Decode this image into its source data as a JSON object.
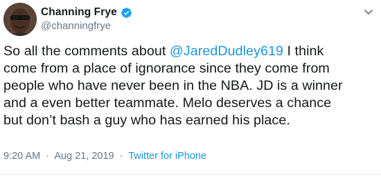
{
  "author": {
    "display_name": "Channing Frye",
    "handle": "@channingfrye",
    "verified": true,
    "verified_color": "#1da1f2"
  },
  "tweet": {
    "line1_before": "So all the comments about ",
    "mention": "@JaredDudley619",
    "line1_after": " I think",
    "line2": "come from a place of ignorance since they come from",
    "line3": "people who have never been in the NBA. JD is a winner",
    "line4": "and a even better teammate. Melo deserves a chance",
    "line5": "but don’t bash a guy who has earned his place."
  },
  "meta": {
    "time": "9:20 AM",
    "separator1": "·",
    "date": "Aug 21, 2019",
    "separator2": "·",
    "source": "Twitter for iPhone"
  },
  "icons": {
    "avatar": "avatar",
    "verified": "verified-badge-icon",
    "menu": "chevron-down-icon"
  },
  "colors": {
    "text": "#14171a",
    "secondary": "#657786",
    "link": "#1b95e0"
  }
}
